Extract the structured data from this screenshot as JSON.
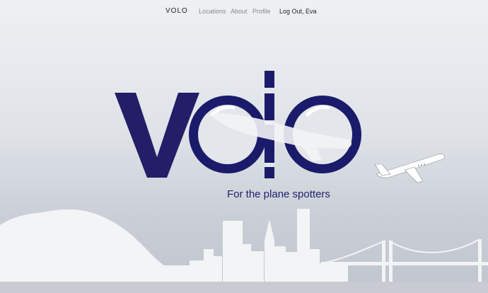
{
  "nav": {
    "brand": "VOLO",
    "links": [
      "Locations",
      "About",
      "Profile"
    ],
    "logout": "Log Out, Eva"
  },
  "hero": {
    "logo_text": "volo",
    "tagline": "For the plane spotters"
  },
  "colors": {
    "logo_navy": "#1b1b6b",
    "logo_purple": "#241e68",
    "skyline": "#f3f4f5",
    "sky_top": "#eef0f3",
    "sky_bottom": "#bfc5ce"
  }
}
